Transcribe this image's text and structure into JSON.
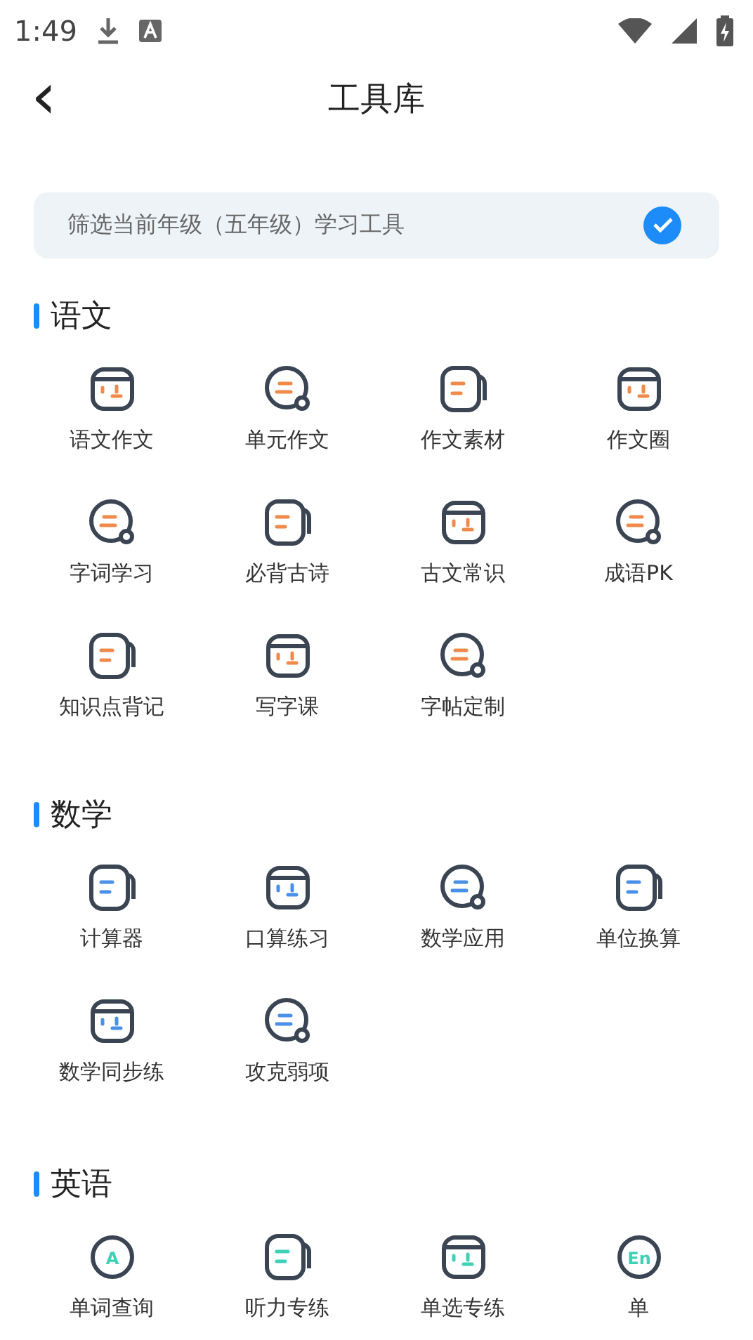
{
  "status_bar": {
    "time": "1:49"
  },
  "header": {
    "back": "‹",
    "title": "工具库"
  },
  "filter": {
    "label": "筛选当前年级（五年级）学习工具",
    "checked": true
  },
  "sections": [
    {
      "title": "语文",
      "tools": [
        {
          "label": "语文作文"
        },
        {
          "label": "单元作文"
        },
        {
          "label": "作文素材"
        },
        {
          "label": "作文圈"
        },
        {
          "label": "字词学习"
        },
        {
          "label": "必背古诗"
        },
        {
          "label": "古文常识"
        },
        {
          "label": "成语PK"
        },
        {
          "label": "知识点背记"
        },
        {
          "label": "写字课"
        },
        {
          "label": "字帖定制"
        }
      ]
    },
    {
      "title": "数学",
      "tools": [
        {
          "label": "计算器"
        },
        {
          "label": "口算练习"
        },
        {
          "label": "数学应用"
        },
        {
          "label": "单位换算"
        },
        {
          "label": "数学同步练"
        },
        {
          "label": "攻克弱项"
        }
      ]
    },
    {
      "title": "英语",
      "tools": [
        {
          "label": "单词查询",
          "icon_text": "A"
        },
        {
          "label": "听力专练"
        },
        {
          "label": "单选专练"
        },
        {
          "label": "单",
          "icon_text": "En"
        }
      ]
    }
  ]
}
